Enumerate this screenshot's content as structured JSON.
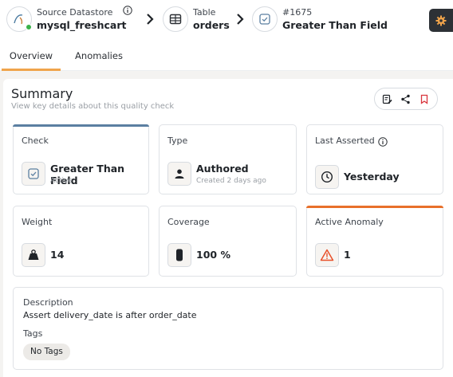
{
  "breadcrumb": {
    "datastore": {
      "label": "Source Datastore",
      "name": "mysql_freshcart",
      "status": "connected"
    },
    "table": {
      "label": "Table",
      "name": "orders"
    },
    "check": {
      "label": "#1675",
      "name": "Greater Than Field"
    }
  },
  "tabs": [
    {
      "label": "Overview",
      "active": true
    },
    {
      "label": "Anomalies",
      "active": false
    }
  ],
  "summary": {
    "title": "Summary",
    "subtitle": "View key details about this quality check"
  },
  "cards": {
    "check": {
      "label": "Check",
      "value": "Greater Than Field",
      "sub": "Active",
      "icon": "check-square-icon"
    },
    "type": {
      "label": "Type",
      "value": "Authored",
      "sub": "Created 2 days ago",
      "icon": "user-icon"
    },
    "last_asserted": {
      "label": "Last Asserted",
      "value": "Yesterday",
      "icon": "clock-icon"
    },
    "weight": {
      "label": "Weight",
      "value": "14",
      "icon": "weight-icon"
    },
    "coverage": {
      "label": "Coverage",
      "value": "100 %",
      "icon": "coverage-icon"
    },
    "active_anomaly": {
      "label": "Active Anomaly",
      "value": "1",
      "icon": "warning-icon"
    }
  },
  "description": {
    "label": "Description",
    "text": "Assert delivery_date is after order_date",
    "tags_label": "Tags",
    "tags": [
      "No Tags"
    ]
  },
  "colors": {
    "accent_orange": "#e8702a",
    "tab_underline": "#f0a44b",
    "check_bar": "#5b7fa1",
    "status_green": "#3ab24a",
    "settings_bg": "#2d3136",
    "warning_red": "#e8502a"
  }
}
